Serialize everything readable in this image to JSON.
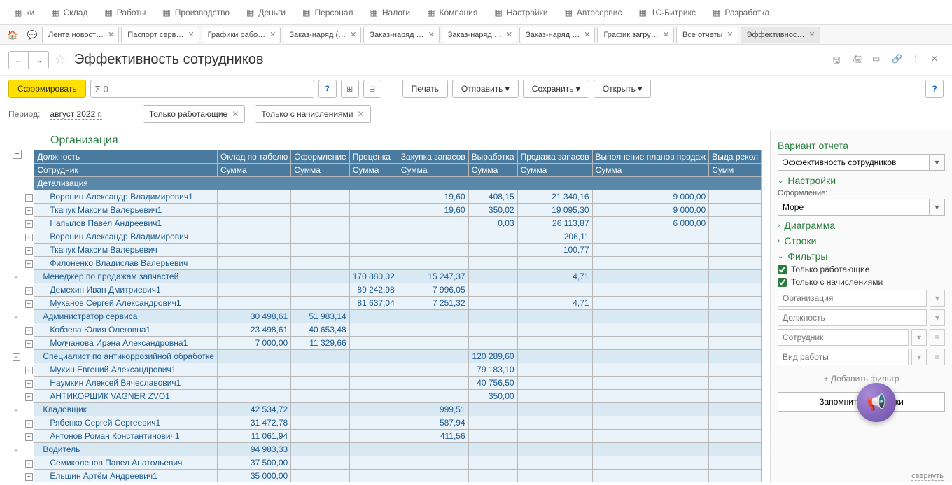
{
  "topnav": [
    {
      "label": "ки",
      "icon": "star"
    },
    {
      "label": "Склад",
      "icon": "box"
    },
    {
      "label": "Работы",
      "icon": "gear"
    },
    {
      "label": "Производство",
      "icon": "factory"
    },
    {
      "label": "Деньги",
      "icon": "ruble"
    },
    {
      "label": "Персонал",
      "icon": "person"
    },
    {
      "label": "Налоги",
      "icon": "scales"
    },
    {
      "label": "Компания",
      "icon": "flag"
    },
    {
      "label": "Настройки",
      "icon": "wrench"
    },
    {
      "label": "Автосервис",
      "icon": "car"
    },
    {
      "label": "1С-Битрикс",
      "icon": "circle"
    },
    {
      "label": "Разработка",
      "icon": "shuffle"
    }
  ],
  "tabs": [
    {
      "label": "Лента новост…"
    },
    {
      "label": "Паспорт серв…"
    },
    {
      "label": "Графики рабо…"
    },
    {
      "label": "Заказ-наряд (…"
    },
    {
      "label": "Заказ-наряд …"
    },
    {
      "label": "Заказ-наряд …"
    },
    {
      "label": "Заказ-наряд …"
    },
    {
      "label": "График загру…"
    },
    {
      "label": "Все отчеты"
    },
    {
      "label": "Эффективнос…",
      "active": true
    }
  ],
  "page_title": "Эффективность сотрудников",
  "actions": {
    "form_btn": "Сформировать",
    "sum_placeholder": "Σ 0",
    "print": "Печать",
    "send": "Отправить",
    "save": "Сохранить",
    "open": "Открыть"
  },
  "period": {
    "label": "Период:",
    "value": "август 2022 г."
  },
  "chips": [
    "Только работающие",
    "Только с начислениями"
  ],
  "report": {
    "org_header": "Организация",
    "columns": [
      "Должность",
      "Оклад по табелю",
      "Оформление",
      "Проценка",
      "Закупка запасов",
      "Выработка",
      "Продажа запасов",
      "Выполнение планов продаж",
      "Выда рекол"
    ],
    "subhead": [
      "Сотрудник",
      "Сумма",
      "Сумма",
      "Сумма",
      "Сумма",
      "Сумма",
      "Сумма",
      "Сумма",
      "Сумм"
    ],
    "detail_label": "Детализация",
    "rows": [
      {
        "type": "emp",
        "name": "Воронин Александр Владимирович1",
        "cells": [
          "",
          "",
          "",
          "19,60",
          "408,15",
          "21 340,16",
          "9 000,00",
          ""
        ]
      },
      {
        "type": "emp",
        "name": "Ткачук Максим Валерьевич1",
        "cells": [
          "",
          "",
          "",
          "19,60",
          "350,02",
          "19 095,30",
          "9 000,00",
          ""
        ]
      },
      {
        "type": "emp",
        "name": "Напылов Павел Андреевич1",
        "cells": [
          "",
          "",
          "",
          "",
          "0,03",
          "26 113,87",
          "6 000,00",
          ""
        ]
      },
      {
        "type": "emp",
        "name": "Воронин Александр Владимирович",
        "cells": [
          "",
          "",
          "",
          "",
          "",
          "206,11",
          "",
          ""
        ]
      },
      {
        "type": "emp",
        "name": "Ткачук Максим Валерьевич",
        "cells": [
          "",
          "",
          "",
          "",
          "",
          "100,77",
          "",
          ""
        ]
      },
      {
        "type": "emp",
        "name": "Филоненко Владислав Валерьевич",
        "cells": [
          "",
          "",
          "",
          "",
          "",
          "",
          "",
          ""
        ]
      },
      {
        "type": "group",
        "name": "Менеджер по продажам запчастей",
        "cells": [
          "",
          "",
          "170 880,02",
          "15 247,37",
          "",
          "4,71",
          "",
          ""
        ]
      },
      {
        "type": "emp",
        "name": "Демехин Иван Дмитриевич1",
        "cells": [
          "",
          "",
          "89 242,98",
          "7 996,05",
          "",
          "",
          "",
          ""
        ]
      },
      {
        "type": "emp",
        "name": "Муханов Сергей Александрович1",
        "cells": [
          "",
          "",
          "81 637,04",
          "7 251,32",
          "",
          "4,71",
          "",
          ""
        ]
      },
      {
        "type": "group",
        "name": "Администратор сервиса",
        "cells": [
          "30 498,61",
          "51 983,14",
          "",
          "",
          "",
          "",
          "",
          ""
        ]
      },
      {
        "type": "emp",
        "name": "Кобзева Юлия Олеговна1",
        "cells": [
          "23 498,61",
          "40 653,48",
          "",
          "",
          "",
          "",
          "",
          ""
        ]
      },
      {
        "type": "emp",
        "name": "Молчанова Ирэна Александровна1",
        "cells": [
          "7 000,00",
          "11 329,66",
          "",
          "",
          "",
          "",
          "",
          ""
        ]
      },
      {
        "type": "group",
        "name": "Специалист по антикоррозийной обработке",
        "cells": [
          "",
          "",
          "",
          "",
          "120 289,60",
          "",
          "",
          ""
        ]
      },
      {
        "type": "emp",
        "name": "Мухин Евгений Александрович1",
        "cells": [
          "",
          "",
          "",
          "",
          "79 183,10",
          "",
          "",
          ""
        ]
      },
      {
        "type": "emp",
        "name": "Наумкин Алексей Вячеславович1",
        "cells": [
          "",
          "",
          "",
          "",
          "40 756,50",
          "",
          "",
          ""
        ]
      },
      {
        "type": "emp",
        "name": "АНТИКОРЩИК VAGNER ZVO1",
        "cells": [
          "",
          "",
          "",
          "",
          "350,00",
          "",
          "",
          ""
        ]
      },
      {
        "type": "group",
        "name": "Кладовщик",
        "cells": [
          "42 534,72",
          "",
          "",
          "999,51",
          "",
          "",
          "",
          ""
        ]
      },
      {
        "type": "emp",
        "name": "Рябенко Сергей Сергеевич1",
        "cells": [
          "31 472,78",
          "",
          "",
          "587,94",
          "",
          "",
          "",
          ""
        ]
      },
      {
        "type": "emp",
        "name": "Антонов Роман Константинович1",
        "cells": [
          "11 061,94",
          "",
          "",
          "411,56",
          "",
          "",
          "",
          ""
        ]
      },
      {
        "type": "group",
        "name": "Водитель",
        "cells": [
          "94 983,33",
          "",
          "",
          "",
          "",
          "",
          "",
          ""
        ]
      },
      {
        "type": "emp",
        "name": "Семиколенов Павел Анатольевич",
        "cells": [
          "37 500,00",
          "",
          "",
          "",
          "",
          "",
          "",
          ""
        ]
      },
      {
        "type": "emp",
        "name": "Ельшин Артём Андреевич1",
        "cells": [
          "35 000,00",
          "",
          "",
          "",
          "",
          "",
          "",
          ""
        ]
      }
    ]
  },
  "side": {
    "variant_title": "Вариант отчета",
    "variant_value": "Эффективность сотрудников",
    "settings_h": "Настройки",
    "decor_label": "Оформление:",
    "decor_value": "Море",
    "diagram_h": "Диаграмма",
    "rows_h": "Строки",
    "filters_h": "Фильтры",
    "check1": "Только работающие",
    "check2": "Только с начислениями",
    "filt_org": "Организация",
    "filt_role": "Должность",
    "filt_emp": "Сотрудник",
    "filt_work": "Вид работы",
    "addfilter": "+ Добавить фильтр",
    "savebtn": "Запомнить настройки",
    "collapse": "свернуть"
  }
}
